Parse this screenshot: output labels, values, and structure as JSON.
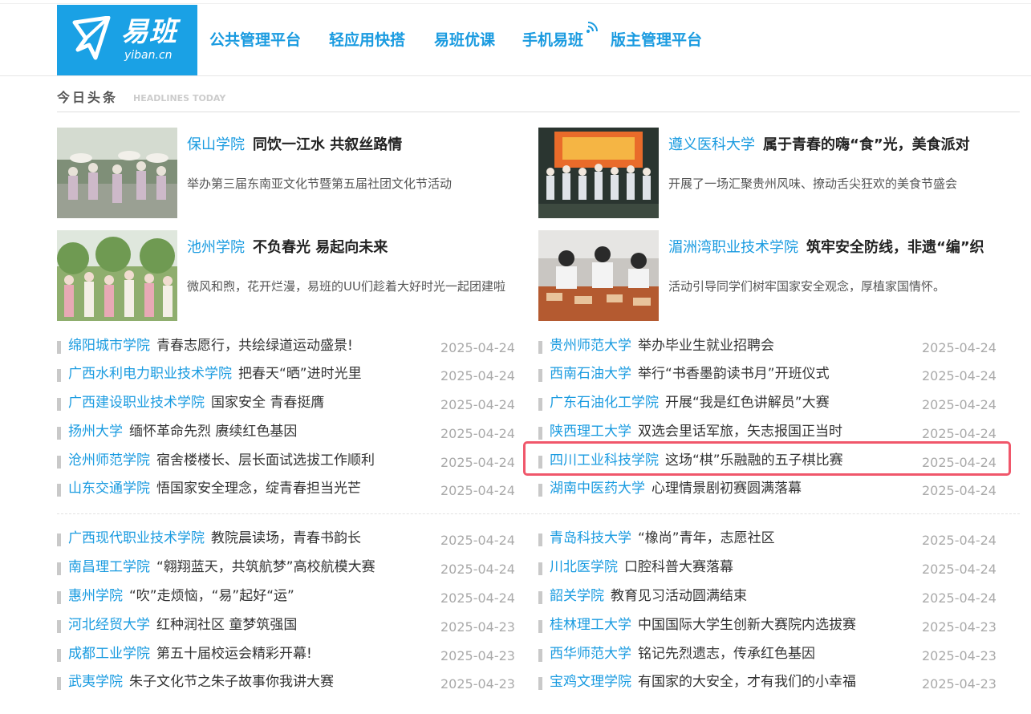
{
  "header": {
    "logo_text": "易班",
    "logo_sub": "yiban.cn",
    "brand_color": "#1aa1e5",
    "nav": [
      {
        "label": "公共管理平台"
      },
      {
        "label": "轻应用快搭"
      },
      {
        "label": "易班优课"
      },
      {
        "label": "手机易班"
      },
      {
        "label": "版主管理平台"
      }
    ]
  },
  "section": {
    "title": "今日头条",
    "subtitle": "HEADLINES TODAY"
  },
  "featured": [
    {
      "school": "保山学院",
      "title": "同饮一江水 共叙丝路情",
      "desc": "举办第三届东南亚文化节暨第五届社团文化节活动"
    },
    {
      "school": "遵义医科大学",
      "title": "属于青春的嗨“食”光，美食派对",
      "desc": "开展了一场汇聚贵州风味、撩动舌尖狂欢的美食节盛会"
    },
    {
      "school": "池州学院",
      "title": "不负春光 易起向未来",
      "desc": "微风和煦，花开烂漫，易班的UU们趁着大好时光一起团建啦"
    },
    {
      "school": "湄洲湾职业技术学院",
      "title": "筑牢安全防线，非遗“编”织",
      "desc": "活动引导同学们树牢国家安全观念，厚植家国情怀。"
    }
  ],
  "news_left_1": [
    {
      "school": "绵阳城市学院",
      "title": "青春志愿行，共绘绿道运动盛景!",
      "date": "2025-04-24"
    },
    {
      "school": "广西水利电力职业技术学院",
      "title": "把春天“晒”进时光里",
      "date": "2025-04-24"
    },
    {
      "school": "广西建设职业技术学院",
      "title": "国家安全 青春挺膺",
      "date": "2025-04-24"
    },
    {
      "school": "扬州大学",
      "title": "缅怀革命先烈 赓续红色基因",
      "date": "2025-04-24"
    },
    {
      "school": "沧州师范学院",
      "title": "宿舍楼楼长、层长面试选拔工作顺利",
      "date": "2025-04-24"
    },
    {
      "school": "山东交通学院",
      "title": "悟国家安全理念，绽青春担当光芒",
      "date": "2025-04-24"
    }
  ],
  "news_right_1": [
    {
      "school": "贵州师范大学",
      "title": "举办毕业生就业招聘会",
      "date": "2025-04-24"
    },
    {
      "school": "西南石油大学",
      "title": "举行“书香墨韵读书月”开班仪式",
      "date": "2025-04-24"
    },
    {
      "school": "广东石油化工学院",
      "title": "开展“我是红色讲解员”大赛",
      "date": "2025-04-24"
    },
    {
      "school": "陕西理工大学",
      "title": "双选会里话军旅，矢志报国正当时",
      "date": "2025-04-24"
    },
    {
      "school": "四川工业科技学院",
      "title": "这场“棋”乐融融的五子棋比赛",
      "date": "2025-04-24"
    },
    {
      "school": "湖南中医药大学",
      "title": "心理情景剧初赛圆满落幕",
      "date": "2025-04-24"
    }
  ],
  "news_left_2": [
    {
      "school": "广西现代职业技术学院",
      "title": "教院晨读场，青春书韵长",
      "date": "2025-04-24"
    },
    {
      "school": "南昌理工学院",
      "title": "“翱翔蓝天，共筑航梦”高校航模大赛",
      "date": "2025-04-24"
    },
    {
      "school": "惠州学院",
      "title": "“吹”走烦恼，“易”起好“运”",
      "date": "2025-04-24"
    },
    {
      "school": "河北经贸大学",
      "title": "红种润社区 童梦筑强国",
      "date": "2025-04-23"
    },
    {
      "school": "成都工业学院",
      "title": "第五十届校运会精彩开幕!",
      "date": "2025-04-23"
    },
    {
      "school": "武夷学院",
      "title": "朱子文化节之朱子故事你我讲大赛",
      "date": "2025-04-23"
    }
  ],
  "news_right_2": [
    {
      "school": "青岛科技大学",
      "title": "“橡尚”青年，志愿社区",
      "date": "2025-04-24"
    },
    {
      "school": "川北医学院",
      "title": "口腔科普大赛落幕",
      "date": "2025-04-24"
    },
    {
      "school": "韶关学院",
      "title": "教育见习活动圆满结束",
      "date": "2025-04-24"
    },
    {
      "school": "桂林理工大学",
      "title": "中国国际大学生创新大赛院内选拔赛",
      "date": "2025-04-23"
    },
    {
      "school": "西华师范大学",
      "title": "铭记先烈遗志，传承红色基因",
      "date": "2025-04-23"
    },
    {
      "school": "宝鸡文理学院",
      "title": "有国家的大安全，才有我们的小幸福",
      "date": "2025-04-23"
    }
  ]
}
